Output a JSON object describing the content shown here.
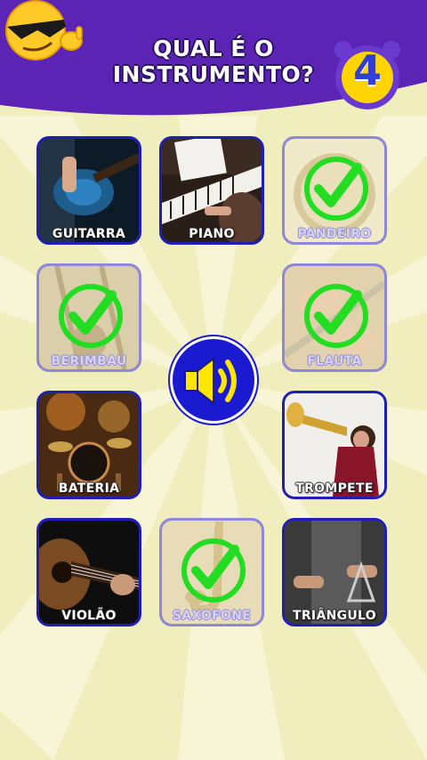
{
  "title": {
    "line1": "QUAL É O",
    "line2": "INSTRUMENTO?"
  },
  "timer": {
    "value": "4"
  },
  "colors": {
    "header": "#5b24b5",
    "card_border": "#1f1fb8",
    "check": "#22dd22",
    "background": "#f1eebd"
  },
  "speaker": {
    "icon": "speaker-icon"
  },
  "cards": [
    {
      "label": "GUITARRA",
      "answered": false
    },
    {
      "label": "PIANO",
      "answered": false
    },
    {
      "label": "PANDEIRO",
      "answered": true
    },
    {
      "label": "BERIMBAU",
      "answered": true
    },
    {
      "label": "FLAUTA",
      "answered": true
    },
    {
      "label": "BATERIA",
      "answered": false
    },
    {
      "label": "TROMPETE",
      "answered": false
    },
    {
      "label": "VIOLÃO",
      "answered": false
    },
    {
      "label": "SAXOFONE",
      "answered": true
    },
    {
      "label": "TRIÂNGULO",
      "answered": false
    }
  ]
}
